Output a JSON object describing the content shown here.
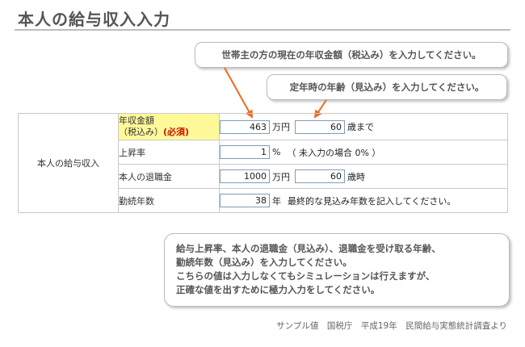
{
  "page": {
    "title": "本人の給与収入入力"
  },
  "callouts": {
    "annual_income": "世帯主の方の現在の年収金額（税込み）を入力してください。",
    "retirement_age": "定年時の年齢（見込み）を入力してください。"
  },
  "form": {
    "section_label": "本人の給与収入",
    "rows": {
      "income": {
        "label_line1": "年収金額",
        "label_line2": "（税込み）",
        "required": "(必須)",
        "amount_value": "463",
        "amount_unit": "万円",
        "age_value": "60",
        "age_unit": "歳まで"
      },
      "raise": {
        "label": "上昇率",
        "value": "1",
        "unit": "%",
        "note": "（ 未入力の場合 0% ）"
      },
      "severance": {
        "label": "本人の退職金",
        "amount_value": "1000",
        "amount_unit": "万円",
        "age_value": "60",
        "age_unit": "歳時"
      },
      "years": {
        "label": "勤続年数",
        "value": "38",
        "unit": "年",
        "note": "最終的な見込み年数を記入してください。"
      }
    }
  },
  "info": {
    "lines": [
      "給与上昇率、本人の退職金（見込み）、退職金を受け取る年齢、",
      "勤続年数（見込み）を入力してください。",
      "こちらの値は入力しなくてもシミュレーションは行えますが、",
      "正確な値を出すために極力入力をしてください。"
    ]
  },
  "source": "サンプル値　国税庁　平成19年　民間給与実態統計調査より",
  "colors": {
    "arrow": "#f06a1f",
    "highlight": "#fff99a",
    "required": "#cc1100",
    "input_border": "#7f9db9"
  }
}
